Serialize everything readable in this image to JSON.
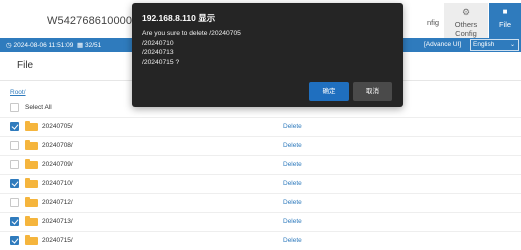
{
  "header": {
    "device_id": "W54276861000018",
    "tabs": [
      {
        "label": "nfig",
        "icon": "",
        "active": false
      },
      {
        "label": "Others Config",
        "icon": "gear-icon",
        "active": false
      },
      {
        "label": "File",
        "icon": "folder-icon",
        "active": true
      }
    ]
  },
  "statusbar": {
    "datetime": "2024-08-06 11:51:09",
    "cpu_partial": "32/51",
    "advance": "[Advance UI]",
    "language": "English"
  },
  "page": {
    "title": "File",
    "breadcrumb": "Root/",
    "select_all_label": "Select All",
    "delete_label": "Delete",
    "files": [
      {
        "name": "20240705/",
        "checked": true
      },
      {
        "name": "20240708/",
        "checked": false
      },
      {
        "name": "20240709/",
        "checked": false
      },
      {
        "name": "20240710/",
        "checked": true
      },
      {
        "name": "20240712/",
        "checked": false
      },
      {
        "name": "20240713/",
        "checked": true
      },
      {
        "name": "20240715/",
        "checked": true
      }
    ]
  },
  "dialog": {
    "title": "192.168.8.110 显示",
    "message_lines": [
      "Are you sure to delete /20240705",
      "/20240710",
      "/20240713",
      "/20240715 ?"
    ],
    "ok_label": "确定",
    "cancel_label": "取消"
  },
  "colors": {
    "accent": "#2f7bbd",
    "folder": "#f5b53d",
    "dialog_bg": "#252525",
    "ok_button": "#1f6fbf"
  }
}
